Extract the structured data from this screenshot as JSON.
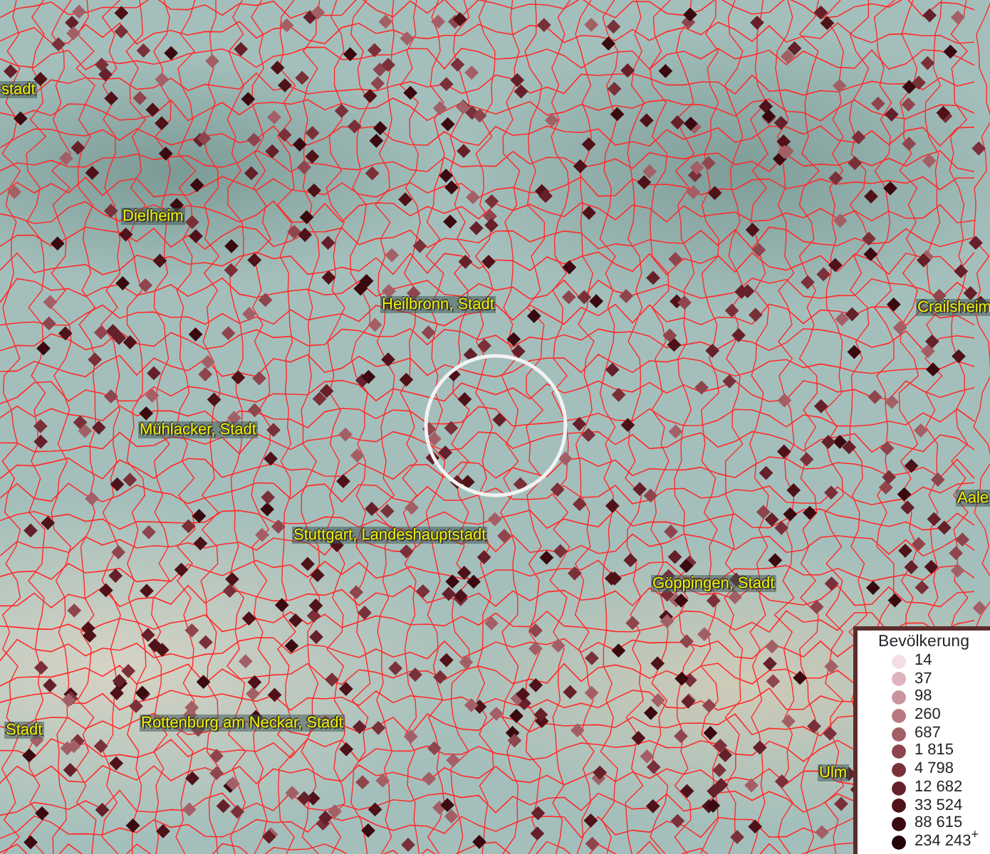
{
  "map": {
    "place_labels": [
      {
        "text": "stadt"
      },
      {
        "text": "Dielheim"
      },
      {
        "text": "Heilbronn, Stadt"
      },
      {
        "text": "Crailsheim"
      },
      {
        "text": "Mühlacker, Stadt"
      },
      {
        "text": "Aale"
      },
      {
        "text": "Stuttgart, Landeshauptstadt"
      },
      {
        "text": "Göppingen, Stadt"
      },
      {
        "text": "Stadt"
      },
      {
        "text": "Rottenburg am Neckar, Stadt"
      },
      {
        "text": "Ulm"
      }
    ]
  },
  "legend": {
    "title": "Bevölkerung",
    "items": [
      {
        "label": "14",
        "color": "#f5dde8"
      },
      {
        "label": "37",
        "color": "#ddb3be"
      },
      {
        "label": "98",
        "color": "#c8959e"
      },
      {
        "label": "260",
        "color": "#b87880"
      },
      {
        "label": "687",
        "color": "#a35f66"
      },
      {
        "label": "1 815",
        "color": "#8e454d"
      },
      {
        "label": "4 798",
        "color": "#7a3039"
      },
      {
        "label": "12 682",
        "color": "#65202a"
      },
      {
        "label": "33 524",
        "color": "#4f1219"
      },
      {
        "label": "88 615",
        "color": "#3a0a10"
      },
      {
        "label": "234 243$^{+}$",
        "color": "#220408"
      }
    ]
  }
}
